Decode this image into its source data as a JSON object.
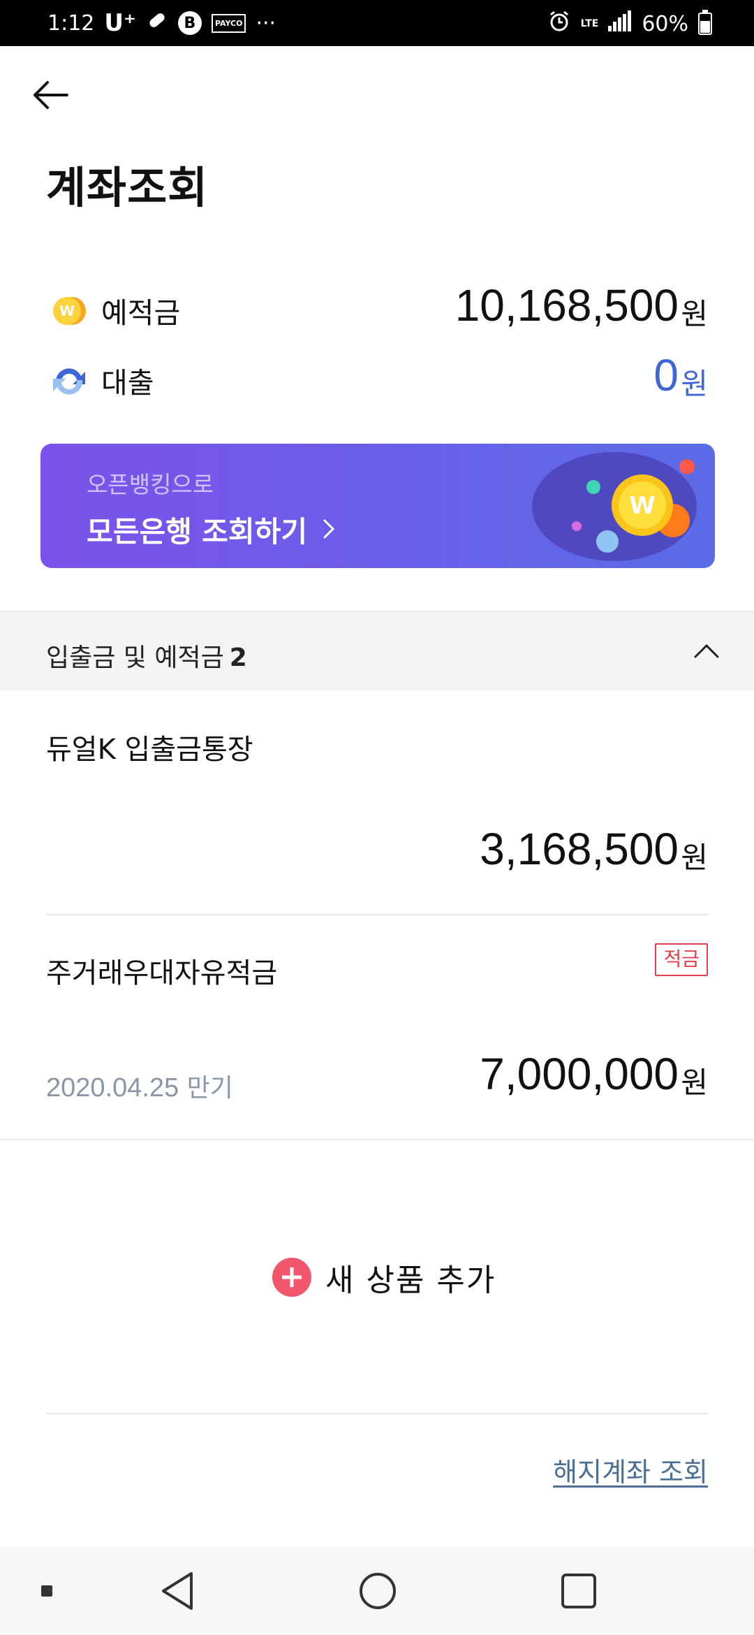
{
  "status_bar": {
    "time": "1:12",
    "carrier": "U⁺",
    "payco_label": "PAYCO",
    "more": "···",
    "network": "LTE",
    "battery": "60%"
  },
  "header": {
    "title": "계좌조회"
  },
  "summary": {
    "deposits_label": "예적금",
    "deposits_amount": "10,168,500",
    "loans_label": "대출",
    "loans_amount": "0",
    "currency": "원"
  },
  "banner": {
    "subtitle": "오픈뱅킹으로",
    "title": "모든은행 조회하기"
  },
  "section": {
    "title": "입출금 및 예적금",
    "count": "2"
  },
  "accounts": [
    {
      "name": "듀얼K 입출금통장",
      "amount": "3,168,500",
      "currency": "원"
    },
    {
      "name": "주거래우대자유적금",
      "badge": "적금",
      "maturity_date": "2020.04.25",
      "maturity_suffix": "만기",
      "amount": "7,000,000",
      "currency": "원"
    }
  ],
  "add_product": {
    "label": "새 상품 추가"
  },
  "closed_accounts_link": "해지계좌 조회",
  "colors": {
    "accent_blue": "#3f66d8",
    "banner_start": "#7b52e9",
    "banner_end": "#5a6ce8",
    "badge_red": "#e0404f",
    "add_pink": "#f0566c",
    "link_blue": "#4a6f92"
  },
  "icons": {
    "deposits": "coin-icon",
    "loans": "refresh-arrow-icon"
  }
}
